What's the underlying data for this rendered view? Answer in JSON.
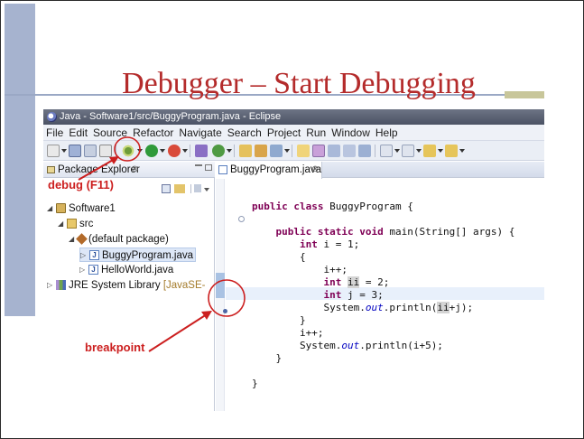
{
  "slide": {
    "title": "Debugger – Start Debugging"
  },
  "window": {
    "title": "Java - Software1/src/BuggyProgram.java - Eclipse"
  },
  "menu": [
    "File",
    "Edit",
    "Source",
    "Refactor",
    "Navigate",
    "Search",
    "Project",
    "Run",
    "Window",
    "Help"
  ],
  "package_explorer": {
    "tab_label": "Package Explorer",
    "close_glyph": "⊗",
    "tree": [
      {
        "label": "Software1",
        "icon": "project-icon",
        "suffix": ""
      },
      {
        "label": "src",
        "icon": "source-folder-icon",
        "suffix": ""
      },
      {
        "label": "(default package)",
        "icon": "package-icon",
        "suffix": ""
      },
      {
        "label": "BuggyProgram.java",
        "icon": "java-file-icon",
        "suffix": ""
      },
      {
        "label": "HelloWorld.java",
        "icon": "java-file-icon",
        "suffix": ""
      },
      {
        "label": "JRE System Library",
        "icon": "library-icon",
        "suffix": "[JavaSE-"
      }
    ]
  },
  "editor": {
    "tab_label": "BuggyProgram.java",
    "close_glyph": "⊗"
  },
  "code_lines": [
    {
      "indent": "",
      "parts": [
        {
          "t": "public class",
          "c": "kw"
        },
        {
          "t": " BuggyProgram {",
          "c": ""
        }
      ]
    },
    {
      "indent": "",
      "parts": []
    },
    {
      "indent": "    ",
      "parts": [
        {
          "t": "public static void",
          "c": "kw"
        },
        {
          "t": " main(String[] args) {",
          "c": ""
        }
      ]
    },
    {
      "indent": "        ",
      "parts": [
        {
          "t": "int",
          "c": "kw"
        },
        {
          "t": " i = 1;",
          "c": ""
        }
      ]
    },
    {
      "indent": "        ",
      "parts": [
        {
          "t": "{",
          "c": ""
        }
      ]
    },
    {
      "indent": "            ",
      "parts": [
        {
          "t": "i++;",
          "c": ""
        }
      ]
    },
    {
      "indent": "            ",
      "parts": [
        {
          "t": "int",
          "c": "kw"
        },
        {
          "t": " ",
          "c": ""
        },
        {
          "t": "ii",
          "c": "hl"
        },
        {
          "t": " = 2;",
          "c": ""
        }
      ]
    },
    {
      "indent": "            ",
      "parts": [
        {
          "t": "int",
          "c": "kw"
        },
        {
          "t": " j = 3;",
          "c": ""
        }
      ]
    },
    {
      "indent": "            ",
      "parts": [
        {
          "t": "System.",
          "c": ""
        },
        {
          "t": "out",
          "c": "fld"
        },
        {
          "t": ".println(",
          "c": ""
        },
        {
          "t": "ii",
          "c": "hl"
        },
        {
          "t": "+j);",
          "c": ""
        }
      ]
    },
    {
      "indent": "        ",
      "parts": [
        {
          "t": "}",
          "c": ""
        }
      ]
    },
    {
      "indent": "        ",
      "parts": [
        {
          "t": "i++;",
          "c": ""
        }
      ]
    },
    {
      "indent": "        ",
      "parts": [
        {
          "t": "System.",
          "c": ""
        },
        {
          "t": "out",
          "c": "fld"
        },
        {
          "t": ".println(i+5);",
          "c": ""
        }
      ]
    },
    {
      "indent": "    ",
      "parts": [
        {
          "t": "}",
          "c": ""
        }
      ]
    },
    {
      "indent": "",
      "parts": []
    },
    {
      "indent": "",
      "parts": [
        {
          "t": "}",
          "c": ""
        }
      ]
    }
  ],
  "annotations": {
    "debug_label": "debug (F11)",
    "breakpoint_label": "breakpoint"
  },
  "colors": {
    "title": "#b42b2b",
    "annotation": "#cc1f1f",
    "keyword": "#7f0055",
    "field": "#0000c0"
  }
}
